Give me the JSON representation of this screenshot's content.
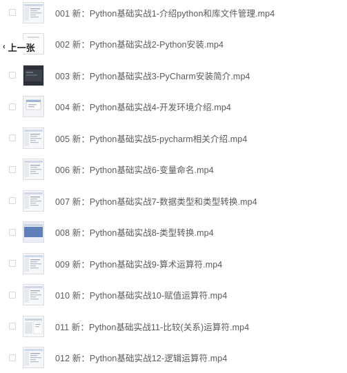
{
  "nav": {
    "prev_label": "上一张",
    "prev_icon": "chevron-left-icon"
  },
  "files": [
    {
      "name": "001 新：Python基础实战1-介绍python和库文件管理.mp4",
      "thumb": "light"
    },
    {
      "name": "002 新：Python基础实战2-Python安装.mp4",
      "thumb": "white"
    },
    {
      "name": "003 新：Python基础实战3-PyCharm安装简介.mp4",
      "thumb": "dark"
    },
    {
      "name": "004 新：Python基础实战4-开发环境介绍.mp4",
      "thumb": "dialog"
    },
    {
      "name": "005 新：Python基础实战5-pycharm相关介绍.mp4",
      "thumb": "light"
    },
    {
      "name": "006 新：Python基础实战6-变量命名.mp4",
      "thumb": "light"
    },
    {
      "name": "007 新：Python基础实战7-数据类型和类型转换.mp4",
      "thumb": "light"
    },
    {
      "name": "008 新：Python基础实战8-类型转换.mp4",
      "thumb": "blue"
    },
    {
      "name": "009 新：Python基础实战9-算术运算符.mp4",
      "thumb": "light"
    },
    {
      "name": "010 新：Python基础实战10-赋值运算符.mp4",
      "thumb": "light"
    },
    {
      "name": "011 新：Python基础实战11-比较(关系)运算符.mp4",
      "thumb": "grid"
    },
    {
      "name": "012 新：Python基础实战12-逻辑运算符.mp4",
      "thumb": "light"
    }
  ]
}
